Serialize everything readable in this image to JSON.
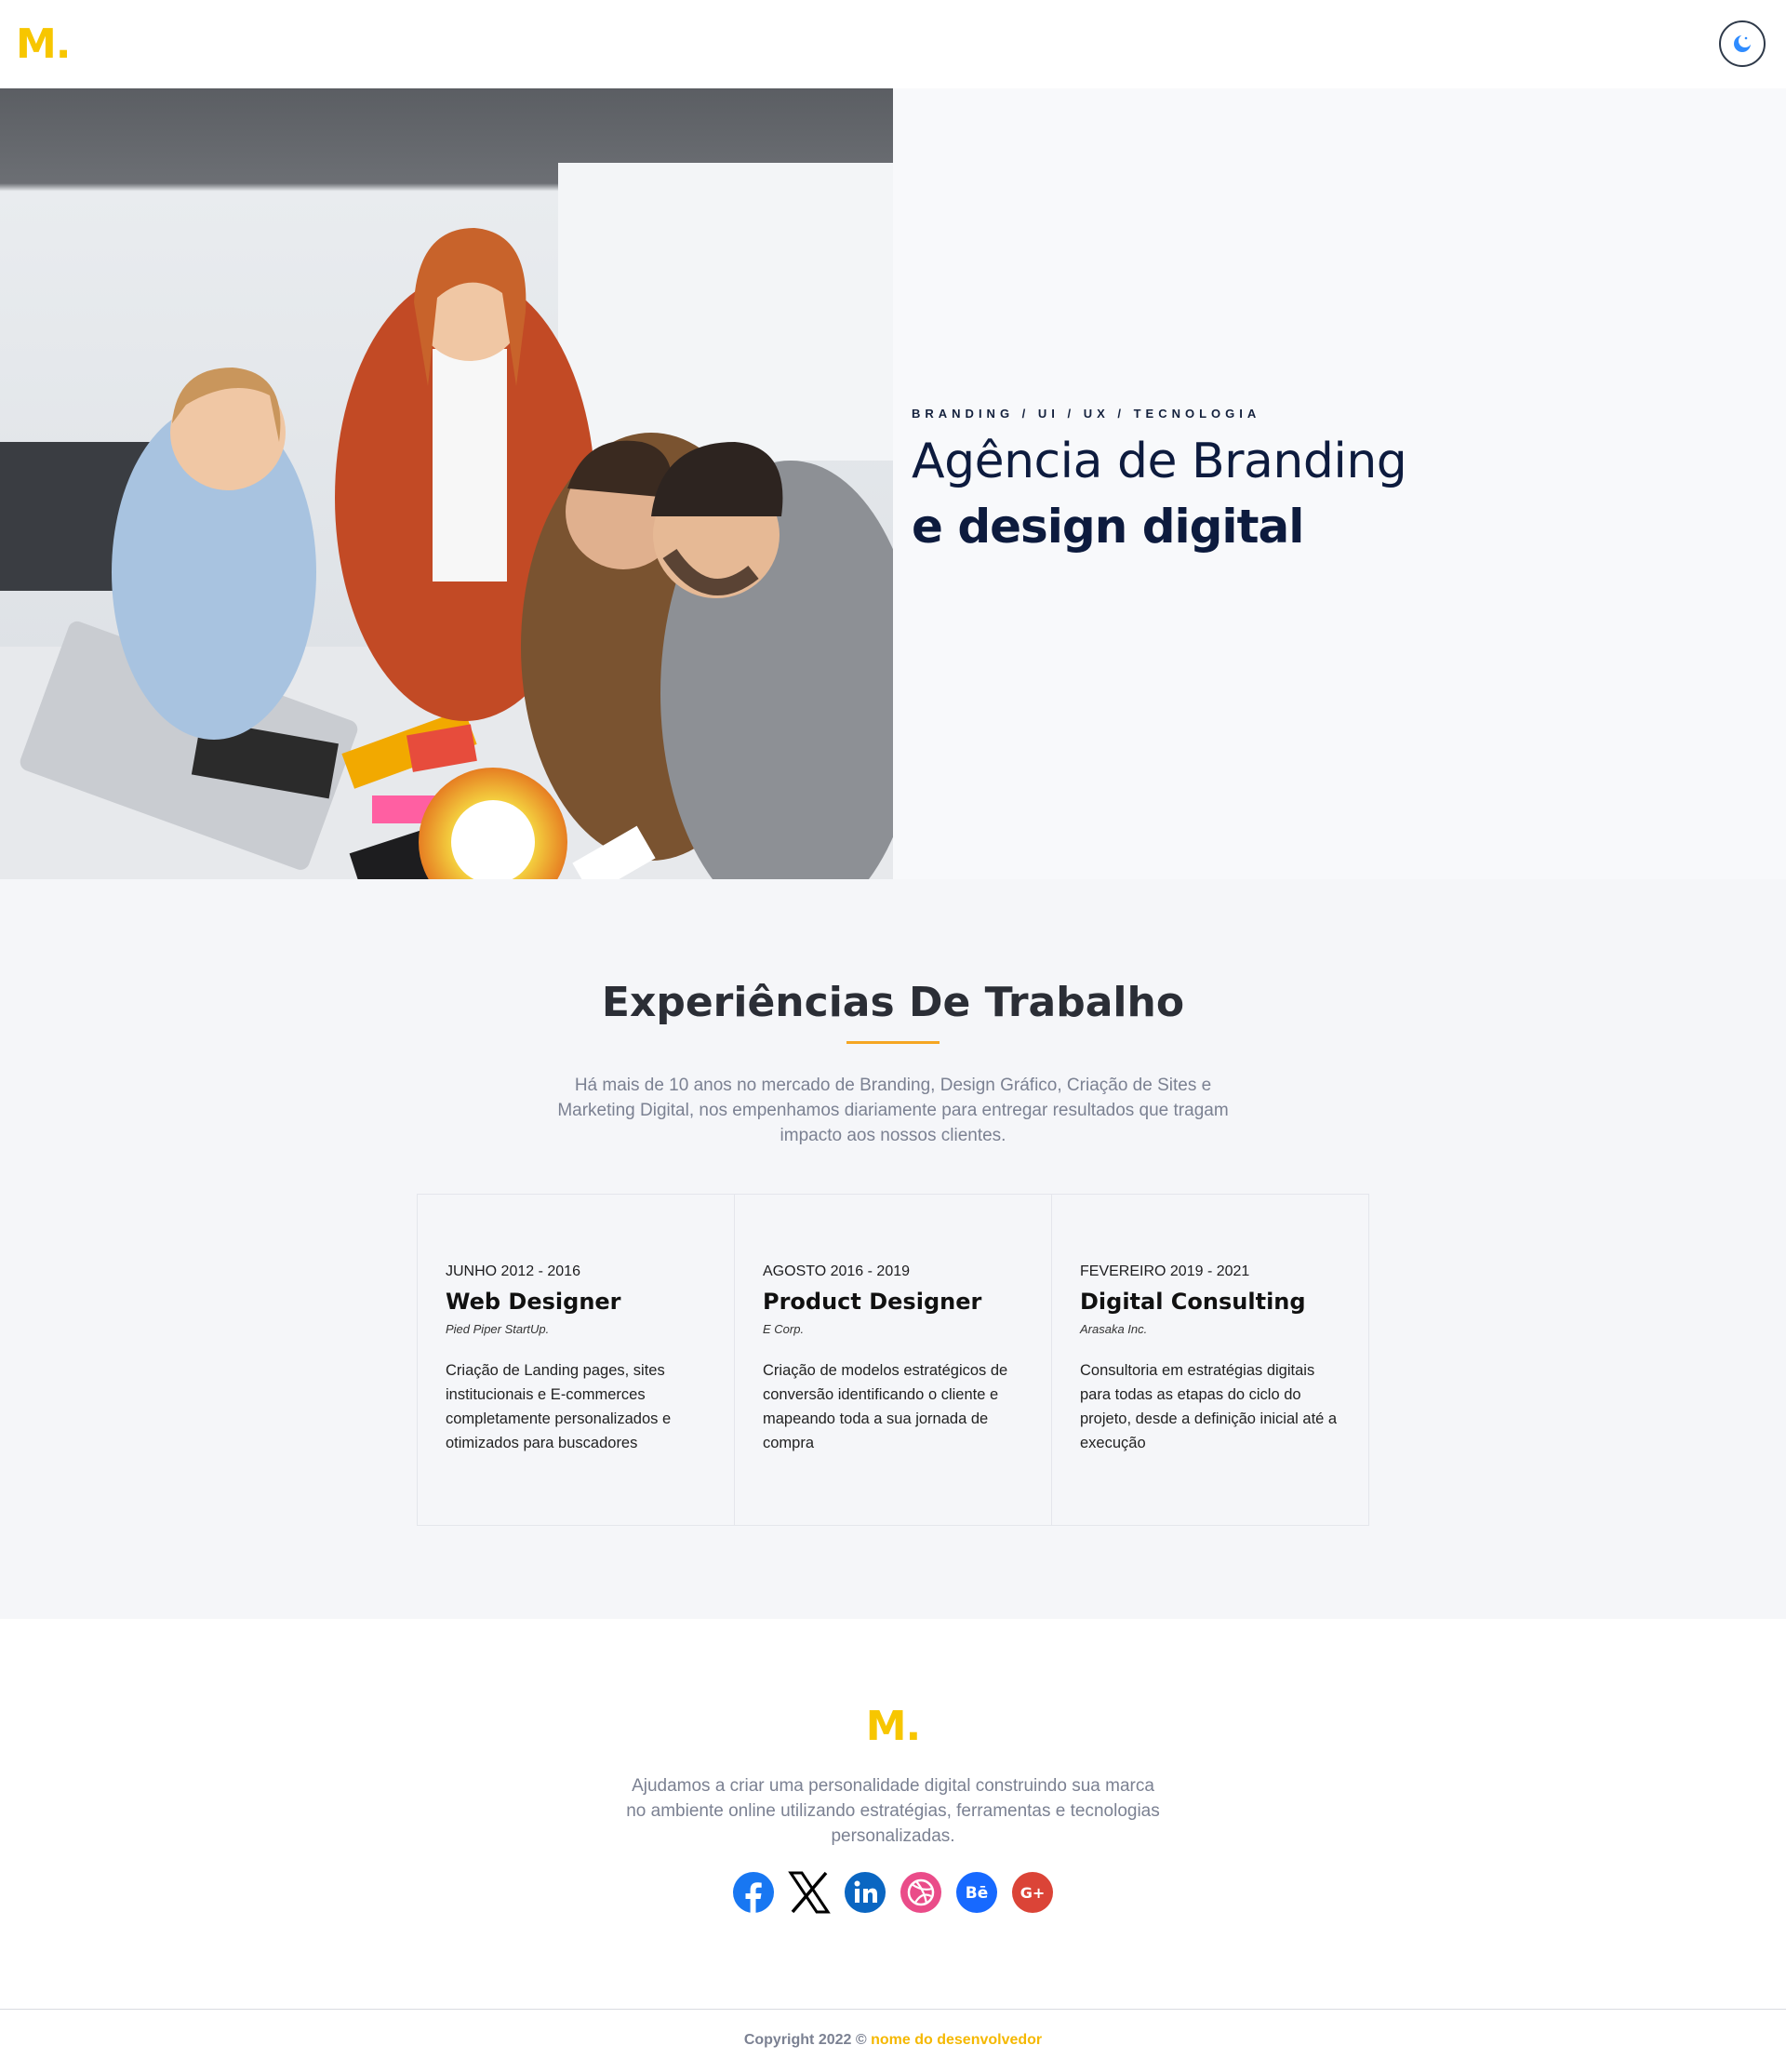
{
  "header": {
    "logo": "M.",
    "theme_toggle_icon": "moon-icon"
  },
  "hero": {
    "tagline": "BRANDING / UI / UX / TECNOLOGIA",
    "title": "Agência de Branding",
    "subtitle": "e design digital"
  },
  "experience": {
    "title": "Experiências De Trabalho",
    "description": "Há mais de 10 anos no mercado de Branding, Design Gráfico, Criação de Sites e Marketing Digital, nos empenhamos diariamente para entregar resultados que tragam impacto aos nossos clientes.",
    "cards": [
      {
        "date": "JUNHO 2012 - 2016",
        "role": "Web Designer",
        "company": "Pied Piper StartUp.",
        "text": "Criação de Landing pages, sites institucionais e E-commerces completamente personalizados e otimizados para buscadores"
      },
      {
        "date": "AGOSTO 2016 - 2019",
        "role": "Product Designer",
        "company": "E Corp.",
        "text": "Criação de modelos estratégicos de conversão identificando o cliente e mapeando toda a sua jornada de compra"
      },
      {
        "date": "FEVEREIRO 2019 - 2021",
        "role": "Digital Consulting",
        "company": "Arasaka Inc.",
        "text": "Consultoria em estratégias digitais para todas as etapas do ciclo do projeto, desde a definição inicial até a execução"
      }
    ]
  },
  "footer": {
    "logo": "M.",
    "description": "Ajudamos a criar uma personalidade digital construindo sua marca no ambiente online utilizando estratégias, ferramentas e tecnologias personalizadas.",
    "socials": [
      {
        "icon": "facebook-icon",
        "color": "#1877f2"
      },
      {
        "icon": "x-icon",
        "color": "#000000"
      },
      {
        "icon": "linkedin-icon",
        "color": "#0a66c2"
      },
      {
        "icon": "dribbble-icon",
        "color": "#ea4c89"
      },
      {
        "icon": "behance-icon",
        "color": "#1769ff"
      },
      {
        "icon": "google-plus-icon",
        "color": "#db4437"
      }
    ],
    "behance_text": "Bē",
    "gplus_text": "G+",
    "copyright_prefix": "Copyright 2022 ©",
    "copyright_dev": "nome do desenvolvedor"
  },
  "colors": {
    "brand_yellow": "#f7c600",
    "accent_orange": "#f5a623",
    "navy": "#0d1b3e"
  }
}
